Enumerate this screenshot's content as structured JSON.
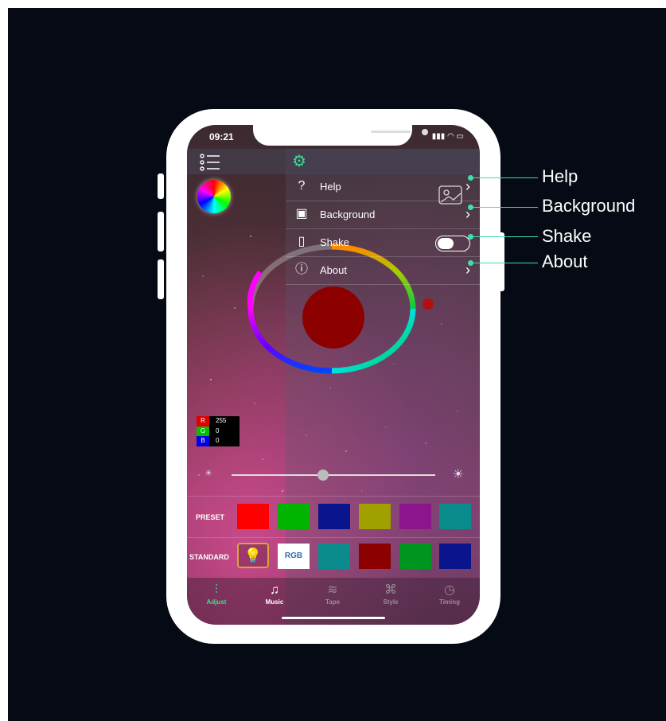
{
  "status_bar": {
    "time": "09:21",
    "signal_icon": "signal-icon",
    "wifi_icon": "wifi-icon",
    "battery_icon": "battery-icon"
  },
  "toolbar": {
    "menu_icon": "list-menu-icon",
    "settings_icon": "gear-icon"
  },
  "menu": [
    {
      "label": "Help",
      "icon": "question-icon",
      "control": "chevron"
    },
    {
      "label": "Background",
      "icon": "image-icon",
      "control": "chevron"
    },
    {
      "label": "Shake",
      "icon": "phone-shake-icon",
      "control": "toggle",
      "toggle_on": false
    },
    {
      "label": "About",
      "icon": "info-icon",
      "control": "chevron"
    }
  ],
  "color_picker": {
    "selected_color": "#8c0000"
  },
  "rgb": {
    "r_label": "R",
    "r": "255",
    "g_label": "G",
    "g": "0",
    "b_label": "B",
    "b": "0"
  },
  "brightness": {
    "level": 0.45
  },
  "preset": {
    "label": "PRESET",
    "colors": [
      "#ff0000",
      "#00b400",
      "#0a148c",
      "#a0a000",
      "#8c148c",
      "#0a8c8c"
    ]
  },
  "standard": {
    "label": "STANDARD",
    "rgb_label": "RGB",
    "colors": [
      "#0a8c8c",
      "#8c0000",
      "#00961e",
      "#0a148c"
    ]
  },
  "tabs": [
    {
      "label": "Adjust",
      "icon": "sliders-icon",
      "active": true
    },
    {
      "label": "Music",
      "icon": "music-note-icon",
      "active": false
    },
    {
      "label": "Tape",
      "icon": "waves-icon",
      "active": false
    },
    {
      "label": "Style",
      "icon": "command-icon",
      "active": false
    },
    {
      "label": "Timing",
      "icon": "timer-icon",
      "active": false
    }
  ],
  "callouts": [
    "Help",
    "Background",
    "Shake",
    "About"
  ],
  "accent_color": "#39e0b0"
}
